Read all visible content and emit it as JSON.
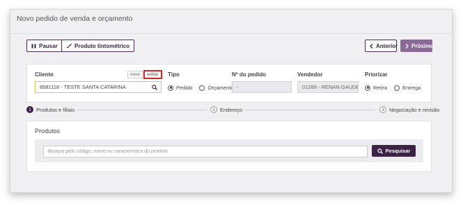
{
  "page": {
    "title": "Novo pedido de venda e orçamento"
  },
  "toolbar": {
    "pause_label": "Pausar",
    "tint_label": "Produto tintométrico",
    "prev_label": "Anterior",
    "next_label": "Próximo"
  },
  "form": {
    "cliente": {
      "label": "Cliente",
      "novo_label": "novo",
      "editar_label": "editar",
      "value": "8581118 - TESTE SANTA CATARINA"
    },
    "tipo": {
      "label": "Tipo",
      "options": [
        "Pedido",
        "Orçamento"
      ],
      "selected": "Pedido"
    },
    "numero_pedido": {
      "label": "Nº do pedido",
      "value": "-"
    },
    "vendedor": {
      "label": "Vendedor",
      "value": "01289 - RENAN GAUDEN"
    },
    "priorizar": {
      "label": "Priorizar",
      "options": [
        "Retira",
        "Entrega"
      ],
      "selected": "Retira"
    }
  },
  "steps": [
    {
      "num": "1",
      "label": "Produtos e filiais",
      "active": true
    },
    {
      "num": "2",
      "label": "Endereço",
      "active": false
    },
    {
      "num": "3",
      "label": "Negociação e revisão",
      "active": false
    }
  ],
  "products": {
    "title": "Produtos",
    "search_placeholder": "Busque pelo código, nome ou característica do produto",
    "search_label": "Pesquisar"
  },
  "colors": {
    "brand": "#3d2247",
    "brand_light": "#8b6a9a",
    "highlight": "#e0231c",
    "focus": "#e3c24f"
  }
}
